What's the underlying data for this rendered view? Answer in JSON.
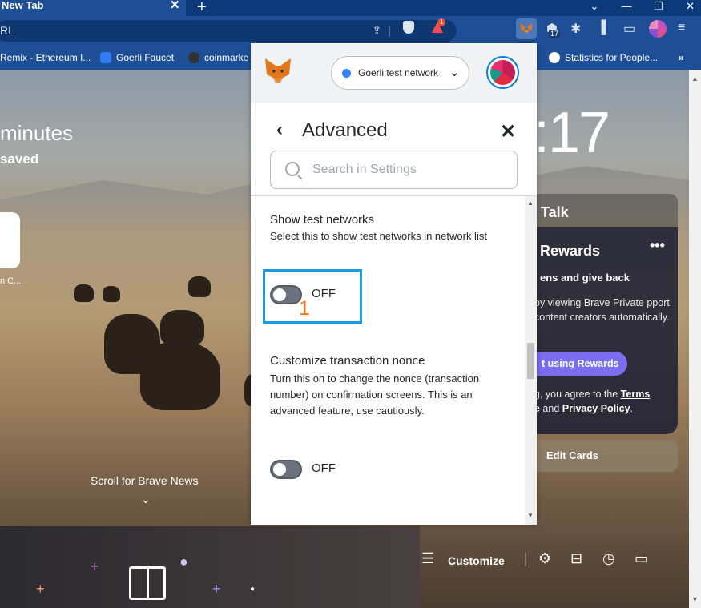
{
  "browser": {
    "tab_title": "New Tab",
    "tab_close": "✕",
    "new_tab": "+",
    "window_controls": [
      "⌄",
      "—",
      "❐",
      "✕"
    ],
    "omnibox_text": "RL",
    "brave_badge_count": "1",
    "extension_badge": "17",
    "bookmarks": [
      {
        "label": "Remix - Ethereum I...",
        "icon_color": "#1e4f96"
      },
      {
        "label": "Goerli Faucet",
        "icon_color": "#2e7bf2"
      },
      {
        "label": "coinmarke",
        "icon_color": "#333"
      },
      {
        "label": "Statistics for People...",
        "icon_color": "#fff"
      }
    ],
    "bookmarks_more": "»"
  },
  "ntp": {
    "minutes": "minutes",
    "saved": "saved",
    "topsite_label": "n C...",
    "clock": ":17",
    "scroll_news": "Scroll for Brave News",
    "scroll_chevron": "⌄",
    "talk_title": "Talk",
    "rewards": {
      "title": "Rewards",
      "more": "•••",
      "subtitle": "ens and give back",
      "body": "by viewing Brave Private pport content creators automatically.",
      "button": "t using Rewards",
      "terms_prefix": "g, you agree to the ",
      "terms_link": "Terms",
      "terms_mid_start": "e",
      "terms_and": " and ",
      "privacy_link": "Privacy Policy",
      "terms_end": "."
    },
    "edit_cards": "Edit Cards",
    "customize": "Customize"
  },
  "metamask": {
    "network": "Goerli test network",
    "network_dot_color": "#3481f5",
    "page_title": "Advanced",
    "search_placeholder": "Search in Settings",
    "settings": [
      {
        "title": "Show test networks",
        "description": "Select this to show test networks in network list",
        "toggle_state": "OFF"
      },
      {
        "title": "Customize transaction nonce",
        "description": "Turn this on to change the nonce (transaction number) on confirmation screens. This is an advanced feature, use cautiously.",
        "toggle_state": "OFF"
      }
    ],
    "annotation_number": "1",
    "annotation_color": "#1a9ae0",
    "annotation_number_color": "#f0761b"
  }
}
